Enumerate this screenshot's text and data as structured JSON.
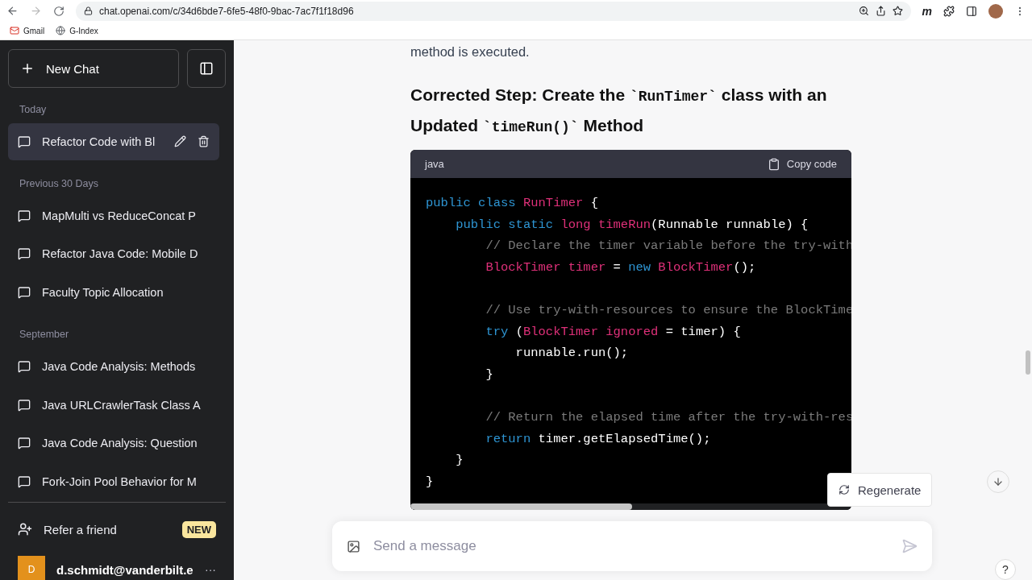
{
  "browser": {
    "url": "chat.openai.com/c/34d6bde7-6fe5-48f0-9bac-7ac7f1f18d96",
    "extension_label": "m",
    "bookmarks": [
      {
        "label": "Gmail",
        "kind": "mail"
      },
      {
        "label": "G-Index",
        "kind": "globe"
      }
    ]
  },
  "sidebar": {
    "new_chat": "New Chat",
    "sections": [
      {
        "label": "Today",
        "items": [
          {
            "title": "Refactor Code with Bl",
            "selected": true
          }
        ]
      },
      {
        "label": "Previous 30 Days",
        "items": [
          {
            "title": "MapMulti vs ReduceConcat P",
            "selected": false
          },
          {
            "title": "Refactor Java Code: Mobile D",
            "selected": false
          },
          {
            "title": "Faculty Topic Allocation",
            "selected": false
          }
        ]
      },
      {
        "label": "September",
        "items": [
          {
            "title": "Java Code Analysis: Methods",
            "selected": false
          },
          {
            "title": "Java URLCrawlerTask Class A",
            "selected": false
          },
          {
            "title": "Java Code Analysis: Question",
            "selected": false
          },
          {
            "title": "Fork-Join Pool Behavior for M",
            "selected": false
          }
        ]
      }
    ],
    "refer": {
      "label": "Refer a friend",
      "badge": "NEW"
    },
    "user": {
      "initial": "D",
      "email": "d.schmidt@vanderbilt.e",
      "more": "···"
    }
  },
  "message": {
    "text": "method is executed.",
    "heading": [
      {
        "text": "Corrected Step: Create the ",
        "kind": "prose"
      },
      {
        "text": "`RunTimer`",
        "kind": "code"
      },
      {
        "text": " class with an Updated ",
        "kind": "prose"
      },
      {
        "text": "`timeRun()`",
        "kind": "code"
      },
      {
        "text": " Method",
        "kind": "prose"
      }
    ],
    "code_block": {
      "language": "java",
      "copy": "Copy code",
      "lines": [
        {
          "kind": "code",
          "tokens": [
            {
              "text": "public class ",
              "kind": "keyword"
            },
            {
              "text": "RunTimer",
              "kind": "name"
            },
            {
              "text": " {",
              "kind": "plain"
            }
          ]
        },
        {
          "kind": "code",
          "tokens": [
            {
              "text": "    public static ",
              "kind": "keyword"
            },
            {
              "text": "long timeRun",
              "kind": "name"
            },
            {
              "text": "(Runnable runnable) {",
              "kind": "plain"
            }
          ]
        },
        {
          "kind": "code",
          "tokens": [
            {
              "text": "        // Declare the timer variable before the try-with",
              "kind": "comment"
            }
          ]
        },
        {
          "kind": "code",
          "tokens": [
            {
              "text": "        BlockTimer timer",
              "kind": "name"
            },
            {
              "text": " = ",
              "kind": "plain"
            },
            {
              "text": "new",
              "kind": "keyword"
            },
            {
              "text": " BlockTimer",
              "kind": "name"
            },
            {
              "text": "();",
              "kind": "plain"
            }
          ]
        },
        {
          "kind": "blank"
        },
        {
          "kind": "code",
          "tokens": [
            {
              "text": "        // Use try-with-resources to ensure the BlockTime",
              "kind": "comment"
            }
          ]
        },
        {
          "kind": "code",
          "tokens": [
            {
              "text": "        try",
              "kind": "keyword"
            },
            {
              "text": " (",
              "kind": "plain"
            },
            {
              "text": "BlockTimer ignored",
              "kind": "name"
            },
            {
              "text": " = timer) {",
              "kind": "plain"
            }
          ]
        },
        {
          "kind": "code",
          "tokens": [
            {
              "text": "            runnable.run();",
              "kind": "plain"
            }
          ]
        },
        {
          "kind": "code",
          "tokens": [
            {
              "text": "        }",
              "kind": "plain"
            }
          ]
        },
        {
          "kind": "blank"
        },
        {
          "kind": "code",
          "tokens": [
            {
              "text": "        // Return the elapsed time after the try-with-res",
              "kind": "comment"
            }
          ]
        },
        {
          "kind": "code",
          "tokens": [
            {
              "text": "        return",
              "kind": "keyword"
            },
            {
              "text": " timer.getElapsedTime();",
              "kind": "plain"
            }
          ]
        },
        {
          "kind": "code",
          "tokens": [
            {
              "text": "    }",
              "kind": "plain"
            }
          ]
        },
        {
          "kind": "code",
          "tokens": [
            {
              "text": "}",
              "kind": "plain"
            }
          ]
        }
      ]
    }
  },
  "regenerate": "Regenerate",
  "composer": {
    "placeholder": "Send a message"
  },
  "help": "?"
}
